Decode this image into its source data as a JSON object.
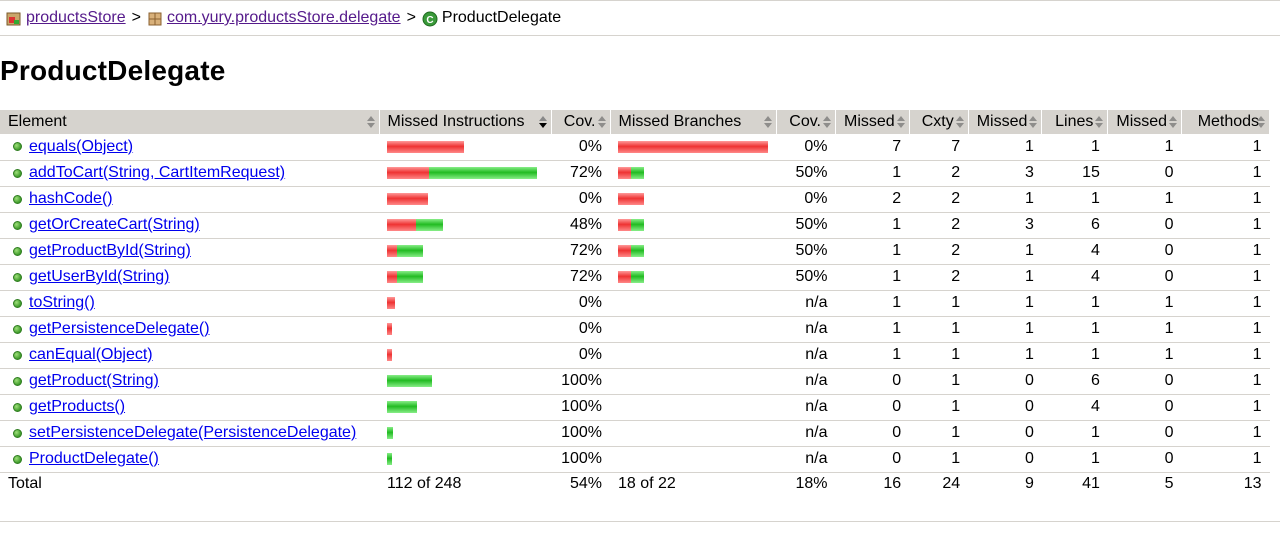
{
  "breadcrumb": {
    "project": "productsStore",
    "package": "com.yury.productsStore.delegate",
    "class": "ProductDelegate",
    "separator": ">"
  },
  "title": "ProductDelegate",
  "headers": {
    "element": "Element",
    "missed_instructions": "Missed Instructions",
    "cov1": "Cov.",
    "missed_branches": "Missed Branches",
    "cov2": "Cov.",
    "missed_cxty": "Missed",
    "cxty": "Cxty",
    "missed_lines": "Missed",
    "lines": "Lines",
    "missed_methods": "Missed",
    "methods": "Methods"
  },
  "rows": [
    {
      "name": "equals(Object)",
      "instr_missed": 1.0,
      "instr_covered": 0.0,
      "instr_scale": 0.51,
      "cov": "0%",
      "br_missed": 1.0,
      "br_covered": 0.0,
      "br_scale": 1.0,
      "br_cov": "0%",
      "m_cx": "7",
      "cx": "7",
      "m_ln": "1",
      "ln": "1",
      "m_mt": "1",
      "mt": "1"
    },
    {
      "name": "addToCart(String, CartItemRequest)",
      "instr_missed": 0.28,
      "instr_covered": 0.72,
      "instr_scale": 1.0,
      "cov": "72%",
      "br_missed": 0.5,
      "br_covered": 0.5,
      "br_scale": 0.17,
      "br_cov": "50%",
      "m_cx": "1",
      "cx": "2",
      "m_ln": "3",
      "ln": "15",
      "m_mt": "0",
      "mt": "1"
    },
    {
      "name": "hashCode()",
      "instr_missed": 1.0,
      "instr_covered": 0.0,
      "instr_scale": 0.27,
      "cov": "0%",
      "br_missed": 1.0,
      "br_covered": 0.0,
      "br_scale": 0.17,
      "br_cov": "0%",
      "m_cx": "2",
      "cx": "2",
      "m_ln": "1",
      "ln": "1",
      "m_mt": "1",
      "mt": "1"
    },
    {
      "name": "getOrCreateCart(String)",
      "instr_missed": 0.52,
      "instr_covered": 0.48,
      "instr_scale": 0.37,
      "cov": "48%",
      "br_missed": 0.5,
      "br_covered": 0.5,
      "br_scale": 0.17,
      "br_cov": "50%",
      "m_cx": "1",
      "cx": "2",
      "m_ln": "3",
      "ln": "6",
      "m_mt": "0",
      "mt": "1"
    },
    {
      "name": "getProductById(String)",
      "instr_missed": 0.28,
      "instr_covered": 0.72,
      "instr_scale": 0.24,
      "cov": "72%",
      "br_missed": 0.5,
      "br_covered": 0.5,
      "br_scale": 0.17,
      "br_cov": "50%",
      "m_cx": "1",
      "cx": "2",
      "m_ln": "1",
      "ln": "4",
      "m_mt": "0",
      "mt": "1"
    },
    {
      "name": "getUserById(String)",
      "instr_missed": 0.28,
      "instr_covered": 0.72,
      "instr_scale": 0.24,
      "cov": "72%",
      "br_missed": 0.5,
      "br_covered": 0.5,
      "br_scale": 0.17,
      "br_cov": "50%",
      "m_cx": "1",
      "cx": "2",
      "m_ln": "1",
      "ln": "4",
      "m_mt": "0",
      "mt": "1"
    },
    {
      "name": "toString()",
      "instr_missed": 1.0,
      "instr_covered": 0.0,
      "instr_scale": 0.05,
      "cov": "0%",
      "br_missed": 0,
      "br_covered": 0,
      "br_scale": 0,
      "br_cov": "n/a",
      "m_cx": "1",
      "cx": "1",
      "m_ln": "1",
      "ln": "1",
      "m_mt": "1",
      "mt": "1"
    },
    {
      "name": "getPersistenceDelegate()",
      "instr_missed": 1.0,
      "instr_covered": 0.0,
      "instr_scale": 0.03,
      "cov": "0%",
      "br_missed": 0,
      "br_covered": 0,
      "br_scale": 0,
      "br_cov": "n/a",
      "m_cx": "1",
      "cx": "1",
      "m_ln": "1",
      "ln": "1",
      "m_mt": "1",
      "mt": "1"
    },
    {
      "name": "canEqual(Object)",
      "instr_missed": 1.0,
      "instr_covered": 0.0,
      "instr_scale": 0.03,
      "cov": "0%",
      "br_missed": 0,
      "br_covered": 0,
      "br_scale": 0,
      "br_cov": "n/a",
      "m_cx": "1",
      "cx": "1",
      "m_ln": "1",
      "ln": "1",
      "m_mt": "1",
      "mt": "1"
    },
    {
      "name": "getProduct(String)",
      "instr_missed": 0.0,
      "instr_covered": 1.0,
      "instr_scale": 0.3,
      "cov": "100%",
      "br_missed": 0,
      "br_covered": 0,
      "br_scale": 0,
      "br_cov": "n/a",
      "m_cx": "0",
      "cx": "1",
      "m_ln": "0",
      "ln": "6",
      "m_mt": "0",
      "mt": "1"
    },
    {
      "name": "getProducts()",
      "instr_missed": 0.0,
      "instr_covered": 1.0,
      "instr_scale": 0.2,
      "cov": "100%",
      "br_missed": 0,
      "br_covered": 0,
      "br_scale": 0,
      "br_cov": "n/a",
      "m_cx": "0",
      "cx": "1",
      "m_ln": "0",
      "ln": "4",
      "m_mt": "0",
      "mt": "1"
    },
    {
      "name": "setPersistenceDelegate(PersistenceDelegate)",
      "instr_missed": 0.0,
      "instr_covered": 1.0,
      "instr_scale": 0.04,
      "cov": "100%",
      "br_missed": 0,
      "br_covered": 0,
      "br_scale": 0,
      "br_cov": "n/a",
      "m_cx": "0",
      "cx": "1",
      "m_ln": "0",
      "ln": "1",
      "m_mt": "0",
      "mt": "1"
    },
    {
      "name": "ProductDelegate()",
      "instr_missed": 0.0,
      "instr_covered": 1.0,
      "instr_scale": 0.03,
      "cov": "100%",
      "br_missed": 0,
      "br_covered": 0,
      "br_scale": 0,
      "br_cov": "n/a",
      "m_cx": "0",
      "cx": "1",
      "m_ln": "0",
      "ln": "1",
      "m_mt": "0",
      "mt": "1"
    }
  ],
  "total": {
    "label": "Total",
    "instr": "112 of 248",
    "cov": "54%",
    "branches": "18 of 22",
    "br_cov": "18%",
    "m_cx": "16",
    "cx": "24",
    "m_ln": "9",
    "ln": "41",
    "m_mt": "5",
    "mt": "13"
  },
  "colors": {
    "header_bg": "#d6d3ce",
    "missed_bar": "#e33333",
    "covered_bar": "#22bb22",
    "link": "#0000ee",
    "visited_link": "#551a8b"
  }
}
